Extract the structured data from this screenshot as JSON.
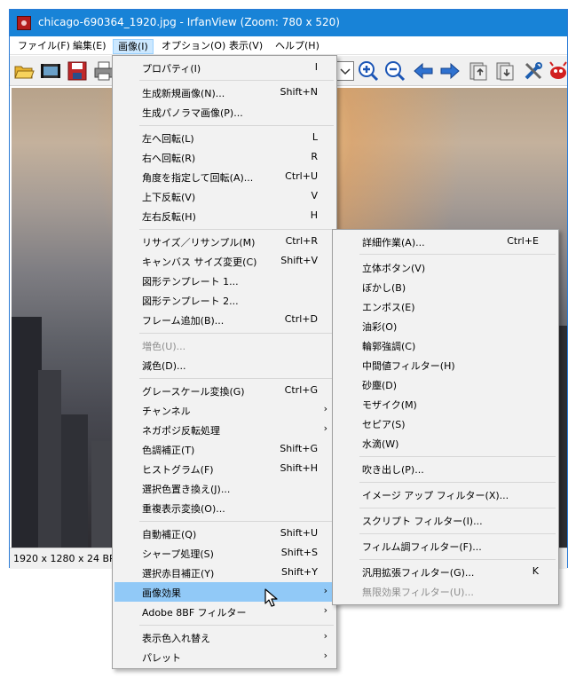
{
  "window": {
    "title": "chicago-690364_1920.jpg - IrfanView (Zoom: 780 x 520)"
  },
  "menubar": [
    {
      "label": "ファイル(F)",
      "name": "menu-file"
    },
    {
      "label": "編集(E)",
      "name": "menu-edit"
    },
    {
      "label": "画像(I)",
      "name": "menu-image",
      "active": true
    },
    {
      "label": "オプション(O)",
      "name": "menu-options"
    },
    {
      "label": "表示(V)",
      "name": "menu-view"
    },
    {
      "label": "ヘルプ(H)",
      "name": "menu-help"
    }
  ],
  "toolbar": [
    "open-folder-icon",
    "slideshow-icon",
    "save-icon",
    "print-icon",
    "zoom-in-icon",
    "zoom-out-icon",
    "previous-arrow-icon",
    "next-arrow-icon",
    "first-file-icon",
    "last-file-icon",
    "options-tools-icon",
    "about-icon"
  ],
  "statusbar": {
    "info": "1920 x 1280 x 24 BPP"
  },
  "image_menu": [
    {
      "label": "プロパティ(I)",
      "shortcut": "I"
    },
    {
      "label": "生成新規画像(N)...",
      "shortcut": "Shift+N"
    },
    {
      "label": "生成パノラマ画像(P)...",
      "shortcut": ""
    },
    {
      "label": "左へ回転(L)",
      "shortcut": "L"
    },
    {
      "label": "右へ回転(R)",
      "shortcut": "R"
    },
    {
      "label": "角度を指定して回転(A)...",
      "shortcut": "Ctrl+U"
    },
    {
      "label": "上下反転(V)",
      "shortcut": "V"
    },
    {
      "label": "左右反転(H)",
      "shortcut": "H"
    },
    {
      "label": "リサイズ／リサンプル(M)",
      "shortcut": "Ctrl+R"
    },
    {
      "label": "キャンバス サイズ変更(C)",
      "shortcut": "Shift+V"
    },
    {
      "label": "図形テンプレート 1...",
      "shortcut": ""
    },
    {
      "label": "図形テンプレート 2...",
      "shortcut": ""
    },
    {
      "label": "フレーム追加(B)...",
      "shortcut": "Ctrl+D"
    },
    {
      "label": "増色(U)...",
      "shortcut": "",
      "disabled": true
    },
    {
      "label": "減色(D)...",
      "shortcut": ""
    },
    {
      "label": "グレースケール変換(G)",
      "shortcut": "Ctrl+G"
    },
    {
      "label": "チャンネル",
      "shortcut": "",
      "submenu": true
    },
    {
      "label": "ネガポジ反転処理",
      "shortcut": "",
      "submenu": true
    },
    {
      "label": "色調補正(T)",
      "shortcut": "Shift+G"
    },
    {
      "label": "ヒストグラム(F)",
      "shortcut": "Shift+H"
    },
    {
      "label": "選択色置き換え(J)...",
      "shortcut": ""
    },
    {
      "label": "重複表示変換(O)...",
      "shortcut": ""
    },
    {
      "label": "自動補正(Q)",
      "shortcut": "Shift+U"
    },
    {
      "label": "シャープ処理(S)",
      "shortcut": "Shift+S"
    },
    {
      "label": "選択赤目補正(Y)",
      "shortcut": "Shift+Y"
    },
    {
      "label": "画像効果",
      "shortcut": "",
      "submenu": true,
      "highlighted": true
    },
    {
      "label": "Adobe 8BF フィルター",
      "shortcut": "",
      "submenu": true
    },
    {
      "label": "表示色入れ替え",
      "shortcut": "",
      "submenu": true
    },
    {
      "label": "パレット",
      "shortcut": "",
      "submenu": true
    }
  ],
  "effects_submenu": [
    {
      "label": "詳細作業(A)...",
      "shortcut": "Ctrl+E"
    },
    {
      "label": "立体ボタン(V)",
      "shortcut": ""
    },
    {
      "label": "ぼかし(B)",
      "shortcut": ""
    },
    {
      "label": "エンボス(E)",
      "shortcut": ""
    },
    {
      "label": "油彩(O)",
      "shortcut": ""
    },
    {
      "label": "輪郭強調(C)",
      "shortcut": ""
    },
    {
      "label": "中間値フィルター(H)",
      "shortcut": ""
    },
    {
      "label": "砂塵(D)",
      "shortcut": ""
    },
    {
      "label": "モザイク(M)",
      "shortcut": ""
    },
    {
      "label": "セピア(S)",
      "shortcut": ""
    },
    {
      "label": "水滴(W)",
      "shortcut": ""
    },
    {
      "label": "吹き出し(P)...",
      "shortcut": ""
    },
    {
      "label": "イメージ アップ フィルター(X)...",
      "shortcut": ""
    },
    {
      "label": "スクリプト フィルター(I)...",
      "shortcut": ""
    },
    {
      "label": "フィルム調フィルター(F)...",
      "shortcut": ""
    },
    {
      "label": "汎用拡張フィルター(G)...",
      "shortcut": "K"
    },
    {
      "label": "無限効果フィルター(U)...",
      "shortcut": "",
      "disabled": true
    }
  ],
  "colors": {
    "titlebar": "#1883d7",
    "menu_highlight": "#91c9f7",
    "menubar_active": "#cce8ff"
  }
}
